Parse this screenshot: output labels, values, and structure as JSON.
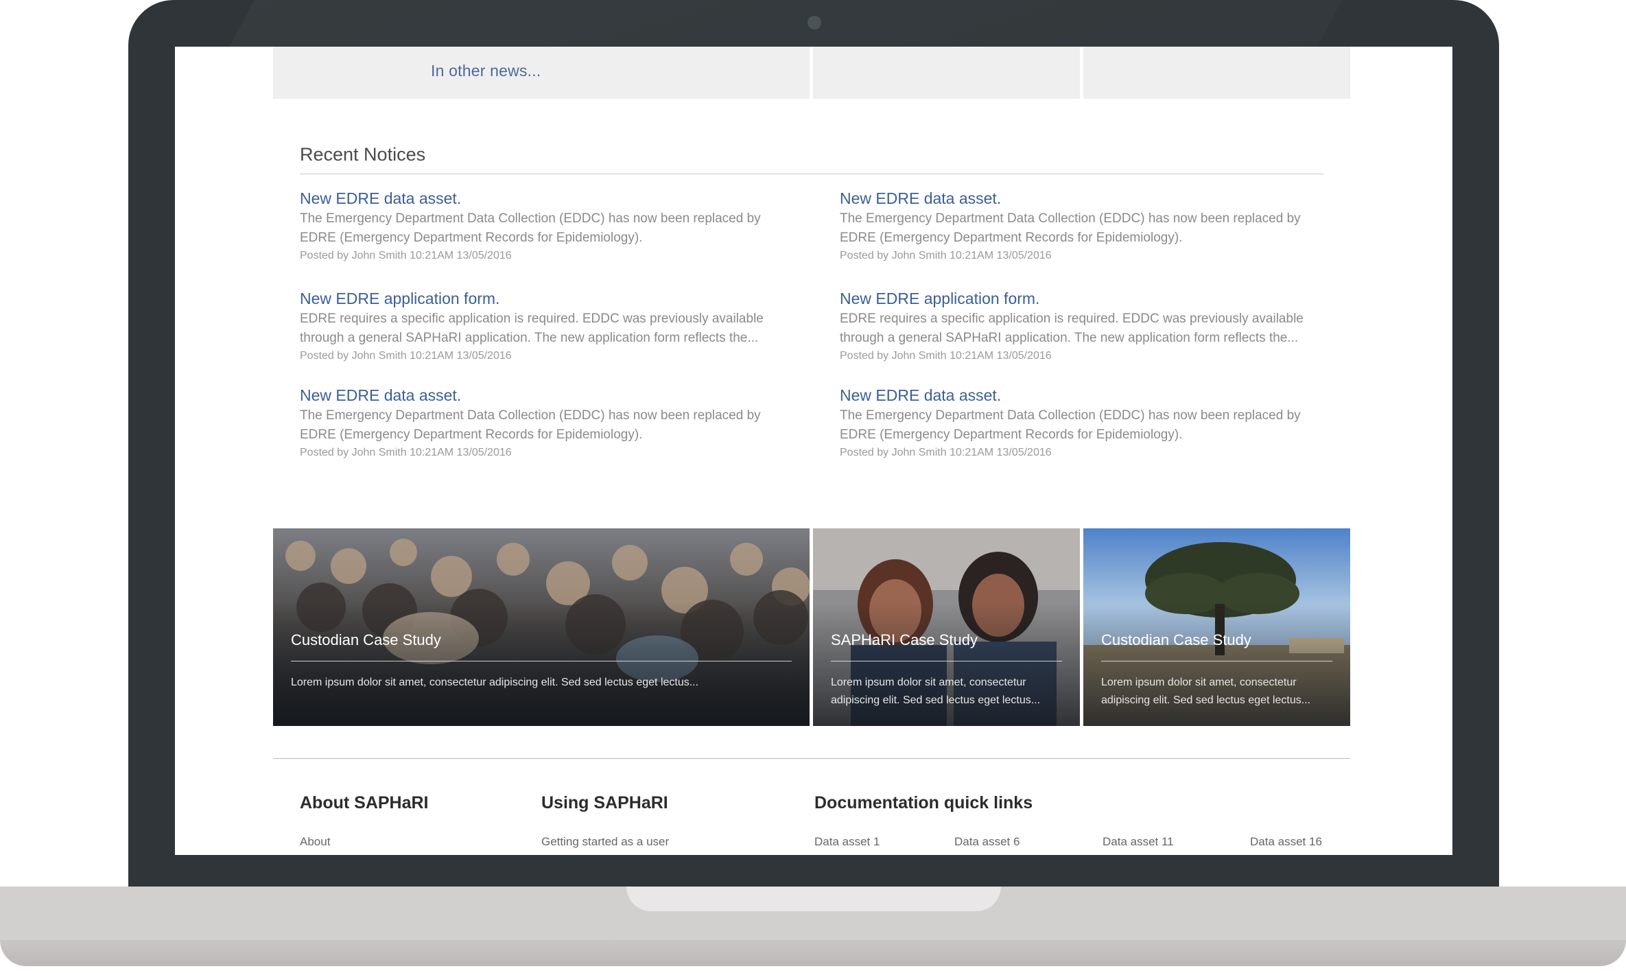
{
  "news_bar": {
    "label": "In other news..."
  },
  "notices": {
    "heading": "Recent Notices",
    "items": [
      {
        "title": "New EDRE data asset.",
        "body": "The Emergency Department Data Collection (EDDC) has now been replaced by EDRE (Emergency Department Records for Epidemiology).",
        "meta": "Posted by John Smith 10:21AM 13/05/2016"
      },
      {
        "title": "New EDRE data asset.",
        "body": "The Emergency Department Data Collection (EDDC) has now been replaced by EDRE (Emergency Department Records for Epidemiology).",
        "meta": "Posted by John Smith 10:21AM 13/05/2016"
      },
      {
        "title": "New EDRE application form.",
        "body": "EDRE requires a specific application is required. EDDC was previously available through a general SAPHaRI application. The new application form reflects the...",
        "meta": "Posted by John Smith 10:21AM 13/05/2016"
      },
      {
        "title": "New EDRE application form.",
        "body": "EDRE requires a specific application is required. EDDC was previously available through a general SAPHaRI application. The new application form reflects the...",
        "meta": "Posted by John Smith 10:21AM 13/05/2016"
      },
      {
        "title": "New EDRE data asset.",
        "body": "The Emergency Department Data Collection (EDDC) has now been replaced by EDRE (Emergency Department Records for Epidemiology).",
        "meta": "Posted by John Smith 10:21AM 13/05/2016"
      },
      {
        "title": "New EDRE data asset.",
        "body": "The Emergency Department Data Collection (EDDC) has now been replaced by EDRE (Emergency Department Records for Epidemiology).",
        "meta": "Posted by John Smith 10:21AM 13/05/2016"
      }
    ]
  },
  "cards": [
    {
      "title": "Custodian Case Study",
      "text": "Lorem ipsum dolor sit amet, consectetur adipiscing elit. Sed sed lectus eget lectus..."
    },
    {
      "title": "SAPHaRI Case Study",
      "text": "Lorem ipsum dolor sit amet, consectetur adipiscing elit. Sed sed lectus eget lectus..."
    },
    {
      "title": "Custodian Case Study",
      "text": "Lorem ipsum dolor sit amet, consectetur adipiscing elit. Sed sed lectus eget lectus..."
    }
  ],
  "footer": {
    "about": {
      "heading": "About SAPHaRI",
      "links": [
        "About"
      ]
    },
    "using": {
      "heading": "Using SAPHaRI",
      "links": [
        "Getting started as a user"
      ]
    },
    "docs": {
      "heading": "Documentation quick links",
      "links": [
        "Data asset 1",
        "Data asset 6",
        "Data asset 11",
        "Data asset 16"
      ]
    }
  },
  "colors": {
    "link": "#3b5f96",
    "bezel": "#2f3538",
    "news_bg": "#efefef"
  }
}
